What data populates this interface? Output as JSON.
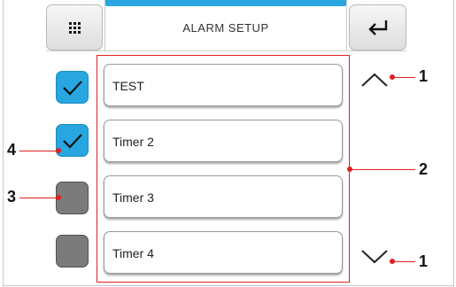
{
  "header": {
    "title": "ALARM SETUP",
    "menu_icon": "grid-menu-icon",
    "back_icon": "return-arrow-icon"
  },
  "alarms": [
    {
      "label": "TEST",
      "checked": true
    },
    {
      "label": "Timer 2",
      "checked": true
    },
    {
      "label": "Timer 3",
      "checked": false
    },
    {
      "label": "Timer 4",
      "checked": false
    }
  ],
  "scroll": {
    "up_icon": "chevron-up-icon",
    "down_icon": "chevron-down-icon"
  },
  "callouts": {
    "up": "1",
    "down": "1",
    "list": "2",
    "checkbox_off": "3",
    "checkbox_on": "4"
  },
  "colors": {
    "accent": "#27a6e0",
    "checkbox_off": "#7b7b7b",
    "callout": "#e0201f"
  }
}
